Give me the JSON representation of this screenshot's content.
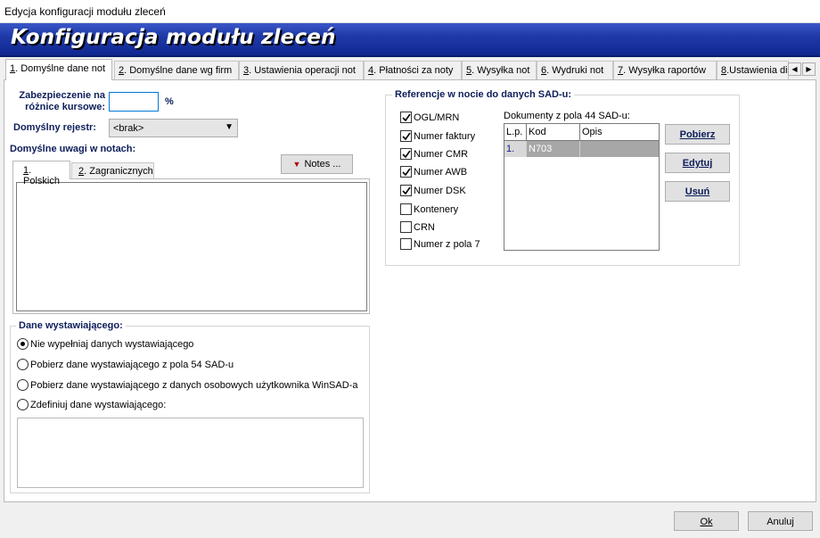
{
  "window": {
    "title": "Edycja konfiguracji modułu zleceń"
  },
  "banner": {
    "title": "Konfiguracja modułu zleceń"
  },
  "tabs": [
    {
      "key": "1",
      "rest": ". Domyślne dane not"
    },
    {
      "key": "2",
      "rest": ". Domyślne dane wg firm"
    },
    {
      "key": "3",
      "rest": ". Ustawienia operacji not"
    },
    {
      "key": "4",
      "rest": ". Płatności za noty"
    },
    {
      "key": "5",
      "rest": ". Wysyłka not"
    },
    {
      "key": "6",
      "rest": ". Wydruki not"
    },
    {
      "key": "7",
      "rest": ". Wysyłka raportów"
    },
    {
      "key": "8",
      "rest": ".Ustawienia di"
    }
  ],
  "exchange": {
    "label_line1": "Zabezpieczenie na",
    "label_line2": "różnice kursowe:",
    "value": "",
    "unit": "%"
  },
  "register": {
    "label": "Domyślny rejestr:",
    "value": "<brak>"
  },
  "notes": {
    "label": "Domyślne uwagi w notach:",
    "button": "Notes ...",
    "subtabs": [
      {
        "key": "1",
        "rest": ". Polskich"
      },
      {
        "key": "2",
        "rest": ". Zagranicznych"
      }
    ],
    "text": ""
  },
  "issuer": {
    "legend": "Dane wystawiającego:",
    "options": [
      {
        "label": "Nie wypełniaj danych wystawiającego",
        "selected": true
      },
      {
        "label": "Pobierz dane wystawiającego z pola 54 SAD-u",
        "selected": false
      },
      {
        "label": "Pobierz dane wystawiającego z danych osobowych użytkownika WinSAD-a",
        "selected": false
      },
      {
        "label": "Zdefiniuj dane wystawiającego:",
        "selected": false
      }
    ],
    "custom_text": ""
  },
  "references": {
    "legend": "Referencje w nocie do danych SAD-u:",
    "checkboxes": [
      {
        "label": "OGL/MRN",
        "checked": true
      },
      {
        "label": "Numer faktury",
        "checked": true
      },
      {
        "label": "Numer CMR",
        "checked": true
      },
      {
        "label": "Numer AWB",
        "checked": true
      },
      {
        "label": "Numer DSK",
        "checked": true
      },
      {
        "label": "Kontenery",
        "checked": false
      },
      {
        "label": "CRN",
        "checked": false
      },
      {
        "label": "Numer z pola 7",
        "checked": false
      }
    ],
    "docs_label": "Dokumenty z pola 44 SAD-u:",
    "columns": [
      "L.p.",
      "Kod",
      "Opis"
    ],
    "rows": [
      {
        "lp": "1.",
        "kod": "N703",
        "opis": ""
      }
    ],
    "buttons": {
      "fetch": "Pobierz",
      "edit": "Edytuj",
      "delete": "Usuń"
    }
  },
  "footer": {
    "ok": "Ok",
    "cancel": "Anuluj"
  }
}
